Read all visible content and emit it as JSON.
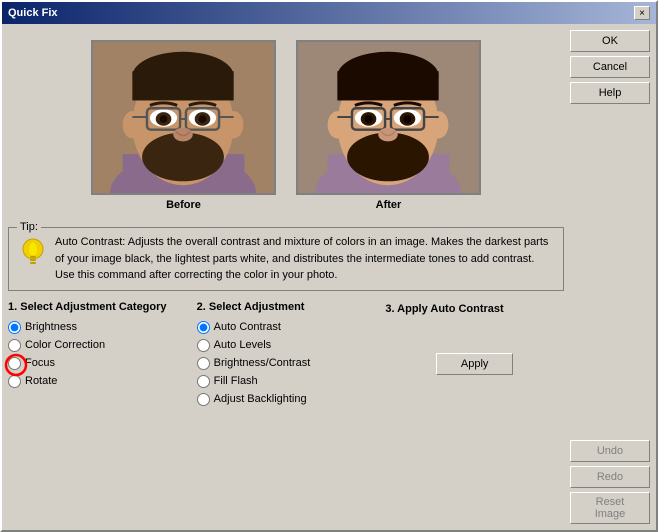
{
  "window": {
    "title": "Quick Fix",
    "close_label": "×"
  },
  "buttons": {
    "ok": "OK",
    "cancel": "Cancel",
    "help": "Help",
    "undo": "Undo",
    "redo": "Redo",
    "reset_image": "Reset Image",
    "apply": "Apply"
  },
  "previews": {
    "before_label": "Before",
    "after_label": "After"
  },
  "tip": {
    "label": "Tip:",
    "text": "Auto Contrast: Adjusts the overall  contrast and mixture of colors in an image. Makes the darkest parts of your  image black, the lightest parts white, and distributes the intermediate tones to  add contrast. Use this command after correcting the color in your  photo."
  },
  "section1": {
    "title": "1. Select Adjustment Category",
    "options": [
      {
        "label": "Brightness",
        "selected": true
      },
      {
        "label": "Color Correction",
        "selected": false
      },
      {
        "label": "Focus",
        "selected": false
      },
      {
        "label": "Rotate",
        "selected": false
      }
    ]
  },
  "section2": {
    "title": "2. Select Adjustment",
    "options": [
      {
        "label": "Auto Contrast",
        "selected": true
      },
      {
        "label": "Auto Levels",
        "selected": false
      },
      {
        "label": "Brightness/Contrast",
        "selected": false
      },
      {
        "label": "Fill Flash",
        "selected": false
      },
      {
        "label": "Adjust Backlighting",
        "selected": false
      }
    ]
  },
  "section3": {
    "title": "3. Apply Auto Contrast"
  }
}
